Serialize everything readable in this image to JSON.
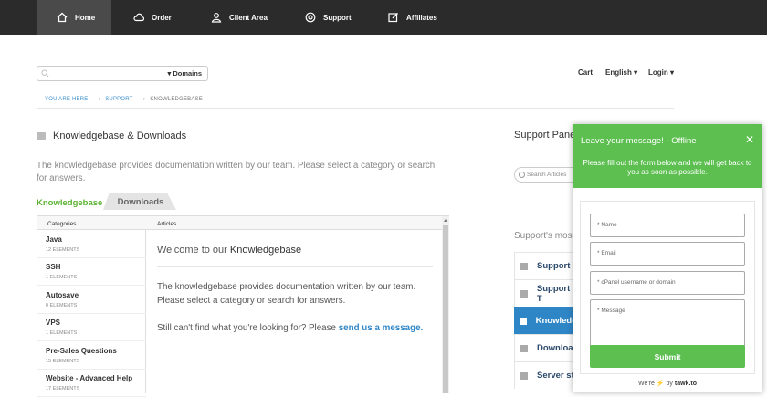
{
  "nav": {
    "items": [
      {
        "label": "Home",
        "icon": "home-icon"
      },
      {
        "label": "Order",
        "icon": "cloud-icon"
      },
      {
        "label": "Client Area",
        "icon": "user-icon"
      },
      {
        "label": "Support",
        "icon": "lifebuoy-icon"
      },
      {
        "label": "Affiliates",
        "icon": "edit-icon"
      }
    ]
  },
  "search": {
    "dropdown_label": "▾ Domains"
  },
  "top_right": {
    "cart": "Cart",
    "language": "English ▾",
    "login": "Login ▾"
  },
  "breadcrumb": {
    "items": [
      "YOU ARE HERE",
      "SUPPORT",
      "KNOWLEDGEBASE"
    ]
  },
  "kb": {
    "title": "Knowledgebase & Downloads",
    "description": "The knowledgebase provides documentation written by our team. Please select a category or search for answers.",
    "tabs": [
      "Knowledgebase",
      "Downloads"
    ],
    "columns": [
      "Categories",
      "Articles"
    ],
    "categories": [
      {
        "name": "Java",
        "count": "12 ELEMENTS"
      },
      {
        "name": "SSH",
        "count": "1 ELEMENTS"
      },
      {
        "name": "Autosave",
        "count": "0 ELEMENTS"
      },
      {
        "name": "VPS",
        "count": "1 ELEMENTS"
      },
      {
        "name": "Pre-Sales Questions",
        "count": "15 ELEMENTS"
      },
      {
        "name": "Website - Advanced Help",
        "count": "17 ELEMENTS"
      }
    ],
    "welcome_prefix": "Welcome to our ",
    "welcome_bold": "Knowledgebase",
    "article_text": "The knowledgebase provides documentation written by our team. Please select a category or search for answers.",
    "question": "Still can't find what you're looking for? Please ",
    "question_link": "send us a message."
  },
  "support_panel": {
    "title": "Support Panel",
    "search_placeholder": "Search Articles",
    "most_label": "Support's most",
    "items": [
      "Support I",
      "Support T",
      "Knowledg",
      "Downloa",
      "Server st"
    ]
  },
  "chat": {
    "title": "Leave your message! - Offline",
    "close": "✕",
    "subtitle": "Please fill out the form below and we will get back to you as soon as possible.",
    "fields": [
      "* Name",
      "* Email",
      "* cPanel username or domain",
      "* Message"
    ],
    "submit": "Submit",
    "powered_prefix": "We're",
    "powered_by": "by",
    "powered_brand": "tawk.to"
  }
}
